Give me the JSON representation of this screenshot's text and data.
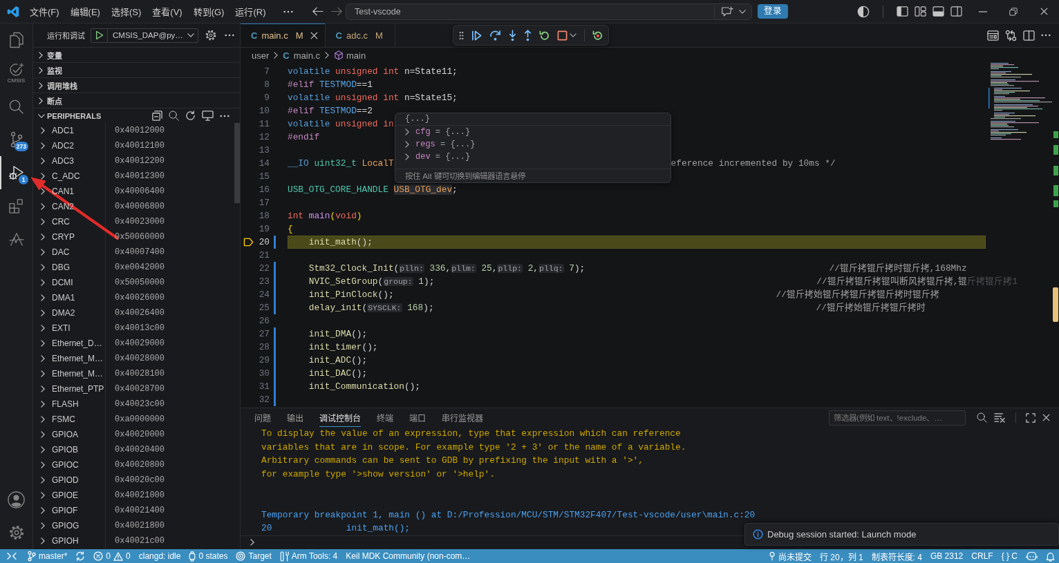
{
  "title_bar": {
    "menus": [
      "文件(F)",
      "编辑(E)",
      "选择(S)",
      "查看(V)",
      "转到(G)",
      "运行(R)"
    ],
    "nav": [
      {
        "kind": "back",
        "disabled": false
      },
      {
        "kind": "forward",
        "disabled": true
      }
    ],
    "command_center": {
      "value": "Test-vscode"
    },
    "login_button": "登录"
  },
  "activity_bar": {
    "items": [
      {
        "kind": "explorer",
        "selected": false
      },
      {
        "kind": "cmsis",
        "label": "CMSIS",
        "selected": false
      },
      {
        "kind": "search",
        "selected": false
      },
      {
        "kind": "source_control",
        "badge": "273",
        "selected": false
      },
      {
        "kind": "debug",
        "badge": "1",
        "selected": true
      },
      {
        "kind": "extensions",
        "selected": false
      },
      {
        "kind": "pulse",
        "selected": false
      }
    ],
    "bottom": [
      {
        "kind": "account"
      },
      {
        "kind": "settings"
      }
    ]
  },
  "sidebar": {
    "title": "运行和调试",
    "launch_config": "CMSIS_DAP@py…",
    "sections": [
      {
        "label": "变量",
        "expanded": false
      },
      {
        "label": "监视",
        "expanded": false
      },
      {
        "label": "调用堆栈",
        "expanded": false
      },
      {
        "label": "断点",
        "expanded": false
      }
    ],
    "peripherals": {
      "label": "PERIPHERALS",
      "expanded": true,
      "rows": [
        {
          "name": "ADC1",
          "address": "0x40012000",
          "expanded": false
        },
        {
          "name": "ADC2",
          "address": "0x40012100",
          "expanded": false
        },
        {
          "name": "ADC3",
          "address": "0x40012200",
          "expanded": false
        },
        {
          "name": "C_ADC",
          "address": "0x40012300",
          "expanded": false
        },
        {
          "name": "CAN1",
          "address": "0x40006400",
          "expanded": false
        },
        {
          "name": "CAN2",
          "address": "0x40006800",
          "expanded": false
        },
        {
          "name": "CRC",
          "address": "0x40023000",
          "expanded": false
        },
        {
          "name": "CRYP",
          "address": "0x50060000",
          "expanded": false
        },
        {
          "name": "DAC",
          "address": "0x40007400",
          "expanded": false
        },
        {
          "name": "DBG",
          "address": "0xe0042000",
          "expanded": false
        },
        {
          "name": "DCMI",
          "address": "0x50050000",
          "expanded": false
        },
        {
          "name": "DMA1",
          "address": "0x40026000",
          "expanded": false
        },
        {
          "name": "DMA2",
          "address": "0x40026400",
          "expanded": false
        },
        {
          "name": "EXTI",
          "address": "0x40013c00",
          "expanded": false
        },
        {
          "name": "Ethernet_D…",
          "address": "0x40029000",
          "expanded": false
        },
        {
          "name": "Ethernet_M…",
          "address": "0x40028000",
          "expanded": false
        },
        {
          "name": "Ethernet_M…",
          "address": "0x40028100",
          "expanded": false
        },
        {
          "name": "Ethernet_PTP",
          "address": "0x40028700",
          "expanded": false
        },
        {
          "name": "FLASH",
          "address": "0x40023c00",
          "expanded": false
        },
        {
          "name": "FSMC",
          "address": "0xa0000000",
          "expanded": false
        },
        {
          "name": "GPIOA",
          "address": "0x40020000",
          "expanded": false
        },
        {
          "name": "GPIOB",
          "address": "0x40020400",
          "expanded": false
        },
        {
          "name": "GPIOC",
          "address": "0x40020800",
          "expanded": false
        },
        {
          "name": "GPIOD",
          "address": "0x40020c00",
          "expanded": false
        },
        {
          "name": "GPIOE",
          "address": "0x40021000",
          "expanded": false
        },
        {
          "name": "GPIOF",
          "address": "0x40021400",
          "expanded": false
        },
        {
          "name": "GPIOG",
          "address": "0x40021800",
          "expanded": false
        },
        {
          "name": "GPIOH",
          "address": "0x40021c00",
          "expanded": false
        }
      ]
    }
  },
  "editor": {
    "tabs": [
      {
        "icon": "C",
        "label": "main.c",
        "status": "M",
        "selected": true
      },
      {
        "icon": "C",
        "label": "adc.c",
        "status": "M",
        "selected": false
      }
    ],
    "breadcrumbs": [
      {
        "kind": "folder",
        "label": "user"
      },
      {
        "kind": "file",
        "icon": "C",
        "label": "main.c"
      },
      {
        "kind": "function",
        "label": "main"
      }
    ],
    "lines": [
      {
        "number": "7",
        "current": false,
        "modified": false,
        "tokens": [
          {
            "text": "volatile",
            "kind": "keyword"
          },
          {
            "text": " unsigned int",
            "kind": "type"
          },
          {
            "text": " n=State11;",
            "kind": "plain"
          }
        ]
      },
      {
        "number": "8",
        "current": false,
        "modified": false,
        "tokens": [
          {
            "text": "#elif",
            "kind": "preprocessor"
          },
          {
            "text": " TESTMOD",
            "kind": "macro"
          },
          {
            "text": "==1",
            "kind": "plain"
          }
        ]
      },
      {
        "number": "9",
        "current": false,
        "modified": false,
        "tokens": [
          {
            "text": "volatile",
            "kind": "keyword"
          },
          {
            "text": " unsigned int",
            "kind": "type"
          },
          {
            "text": " n=State15;",
            "kind": "plain"
          }
        ]
      },
      {
        "number": "10",
        "current": false,
        "modified": false,
        "tokens": [
          {
            "text": "#elif",
            "kind": "preprocessor"
          },
          {
            "text": " TESTMOD",
            "kind": "macro"
          },
          {
            "text": "==2",
            "kind": "plain"
          }
        ]
      },
      {
        "number": "11",
        "current": false,
        "modified": false,
        "tokens": [
          {
            "text": "volatile",
            "kind": "keyword"
          },
          {
            "text": " unsigned in",
            "kind": "type"
          }
        ]
      },
      {
        "number": "12",
        "current": false,
        "modified": false,
        "tokens": [
          {
            "text": "#endif",
            "kind": "preprocessor"
          }
        ]
      },
      {
        "number": "13",
        "current": false,
        "modified": false
      },
      {
        "number": "14",
        "current": false,
        "modified": false,
        "tokens": [
          {
            "text": "__IO",
            "kind": "keyword"
          },
          {
            "text": " uint32_t",
            "kind": "typename"
          },
          {
            "text": " LocalT",
            "kind": "variable"
          }
        ],
        "tail": [
          {
            "text": "eference incremented by 10ms */",
            "kind": "comment"
          }
        ]
      },
      {
        "number": "15",
        "current": false,
        "modified": false
      },
      {
        "number": "16",
        "current": false,
        "modified": false,
        "tokens": [
          {
            "text": "USB_OTG_CORE_HANDLE ",
            "kind": "typename"
          },
          {
            "text": "USB_OTG_dev",
            "kind": "hovered"
          },
          {
            "text": ";",
            "kind": "plain"
          }
        ]
      },
      {
        "number": "17",
        "current": false,
        "modified": false
      },
      {
        "number": "18",
        "current": false,
        "modified": false,
        "tokens": [
          {
            "text": "int",
            "kind": "type"
          },
          {
            "text": " main",
            "kind": "function_def"
          },
          {
            "text": "(",
            "kind": "bracket"
          },
          {
            "text": "void",
            "kind": "type"
          },
          {
            "text": ")",
            "kind": "bracket"
          }
        ]
      },
      {
        "number": "19",
        "current": false,
        "modified": false,
        "tokens": [
          {
            "text": "{",
            "kind": "bracket"
          }
        ]
      },
      {
        "number": "20",
        "current": true,
        "modified": true,
        "tokens": [
          {
            "text": "    init_math",
            "kind": "function"
          },
          {
            "text": "();",
            "kind": "plain"
          }
        ]
      },
      {
        "number": "21",
        "current": false,
        "modified": false
      },
      {
        "number": "22",
        "current": false,
        "modified": true,
        "tokens": [
          {
            "text": "    Stm32_Clock_Init",
            "kind": "function"
          },
          {
            "text": "(",
            "kind": "plain"
          },
          {
            "text": "plln:",
            "kind": "hint"
          },
          {
            "text": " 336",
            "kind": "number"
          },
          {
            "text": ",",
            "kind": "plain"
          },
          {
            "text": "pllm:",
            "kind": "hint"
          },
          {
            "text": " 25",
            "kind": "number"
          },
          {
            "text": ",",
            "kind": "plain"
          },
          {
            "text": "pllp:",
            "kind": "hint"
          },
          {
            "text": " 2",
            "kind": "number"
          },
          {
            "text": ",",
            "kind": "plain"
          },
          {
            "text": "pllq:",
            "kind": "hint"
          },
          {
            "text": " 7",
            "kind": "number"
          },
          {
            "text": ");",
            "kind": "plain"
          }
        ],
        "comment": [
          {
            "text": "                                              //锟斤拷锟斤拷时锟斤拷,168Mhz",
            "kind": "comment"
          }
        ]
      },
      {
        "number": "23",
        "current": false,
        "modified": true,
        "tokens": [
          {
            "text": "    NVIC_SetGroup",
            "kind": "function"
          },
          {
            "text": "(",
            "kind": "plain"
          },
          {
            "text": "group:",
            "kind": "hint"
          },
          {
            "text": " 1",
            "kind": "number"
          },
          {
            "text": ");",
            "kind": "plain"
          }
        ],
        "comment": [
          {
            "text": "                                                                        //锟斤拷锟斤拷锟叫断风拷锟斤拷,锟",
            "kind": "comment"
          },
          {
            "text": "斤拷锟斤拷1",
            "kind": "faded"
          }
        ]
      },
      {
        "number": "24",
        "current": false,
        "modified": true,
        "tokens": [
          {
            "text": "    init_PinClock",
            "kind": "function"
          },
          {
            "text": "();",
            "kind": "plain"
          }
        ],
        "comment": [
          {
            "text": "                                                                        //锟斤拷始锟斤拷锟斤拷锟斤拷时锟斤拷",
            "kind": "comment"
          }
        ]
      },
      {
        "number": "25",
        "current": false,
        "modified": true,
        "tokens": [
          {
            "text": "    delay_init",
            "kind": "function"
          },
          {
            "text": "(",
            "kind": "plain"
          },
          {
            "text": "SYSCLK:",
            "kind": "hint"
          },
          {
            "text": " 168",
            "kind": "number"
          },
          {
            "text": ");",
            "kind": "plain"
          }
        ],
        "comment": [
          {
            "text": "                                                                        //锟斤拷始锟斤拷锟斤拷时",
            "kind": "comment"
          }
        ]
      },
      {
        "number": "26",
        "current": false,
        "modified": false
      },
      {
        "number": "27",
        "current": false,
        "modified": true,
        "tokens": [
          {
            "text": "    init_DMA",
            "kind": "function"
          },
          {
            "text": "();",
            "kind": "plain"
          }
        ]
      },
      {
        "number": "28",
        "current": false,
        "modified": true,
        "tokens": [
          {
            "text": "    init_timer",
            "kind": "function"
          },
          {
            "text": "();",
            "kind": "plain"
          }
        ]
      },
      {
        "number": "29",
        "current": false,
        "modified": true,
        "tokens": [
          {
            "text": "    init_ADC",
            "kind": "function"
          },
          {
            "text": "();",
            "kind": "plain"
          }
        ]
      },
      {
        "number": "30",
        "current": false,
        "modified": true,
        "tokens": [
          {
            "text": "    init_DAC",
            "kind": "function"
          },
          {
            "text": "();",
            "kind": "plain"
          }
        ]
      },
      {
        "number": "31",
        "current": false,
        "modified": true,
        "tokens": [
          {
            "text": "    init_Communication",
            "kind": "function"
          },
          {
            "text": "();",
            "kind": "plain"
          }
        ]
      },
      {
        "number": "32",
        "current": false,
        "modified": true
      }
    ],
    "hover": {
      "header": "{...}",
      "items": [
        {
          "name": "cfg",
          "operator": "=",
          "value": "{...}",
          "expanded": false
        },
        {
          "name": "regs",
          "operator": "=",
          "value": "{...}",
          "expanded": false
        },
        {
          "name": "dev",
          "operator": "=",
          "value": "{...}",
          "expanded": false
        }
      ],
      "footer": "按住 Alt 键可切换到编辑器语言悬停"
    }
  },
  "panel": {
    "tabs": [
      {
        "label": "问题",
        "selected": false
      },
      {
        "label": "输出",
        "selected": false
      },
      {
        "label": "调试控制台",
        "selected": true
      },
      {
        "label": "终端",
        "selected": false
      },
      {
        "label": "端口",
        "selected": false
      },
      {
        "label": "串行监视器",
        "selected": false
      }
    ],
    "filter": {
      "placeholder": "筛选器(例如 text、!exclude、…"
    },
    "console": [
      {
        "kind": "warning",
        "text": "To display the value of an expression, type that expression which can reference"
      },
      {
        "kind": "warning",
        "text": "variables that are in scope. For example type '2 + 3' or the name of a variable."
      },
      {
        "kind": "warning",
        "text": "Arbitrary commands can be sent to GDB by prefixing the input with a '>',"
      },
      {
        "kind": "warning",
        "text": "for example type '>show version' or '>help'."
      },
      {
        "kind": "blank"
      },
      {
        "kind": "blank"
      },
      {
        "kind": "info",
        "text": "Temporary breakpoint 1, main () at D:/Profession/MCU/STM/STM32F407/Test-vscode/user\\main.c:20"
      },
      {
        "kind": "info",
        "text": "20              init_math();"
      }
    ]
  },
  "notification": {
    "kind": "info",
    "text": "Debug session started: Launch mode"
  },
  "status_bar": {
    "left": [
      {
        "kind": "remote"
      },
      {
        "kind": "branch",
        "text": "master*"
      },
      {
        "kind": "sync"
      },
      {
        "kind": "problems",
        "errors": "0",
        "warnings": "0"
      },
      {
        "kind": "plain",
        "text": "clangd: idle"
      },
      {
        "kind": "watch",
        "text": "0 states"
      },
      {
        "kind": "target",
        "text": "Target"
      },
      {
        "kind": "tools",
        "text": "Arm Tools: 4"
      },
      {
        "kind": "plain",
        "text": "Keil MDK Community (non-com…"
      }
    ],
    "right": [
      {
        "kind": "commit",
        "text": "尚未提交"
      },
      {
        "kind": "plain",
        "text": "行 20，列 1"
      },
      {
        "kind": "plain",
        "text": "制表符长度: 4"
      },
      {
        "kind": "plain",
        "text": "GB 2312"
      },
      {
        "kind": "plain",
        "text": "CRLF"
      },
      {
        "kind": "language",
        "symbol": "{ }",
        "text": "C"
      },
      {
        "kind": "copilot"
      },
      {
        "kind": "bell"
      }
    ]
  },
  "annotation": {
    "kind": "arrow"
  }
}
